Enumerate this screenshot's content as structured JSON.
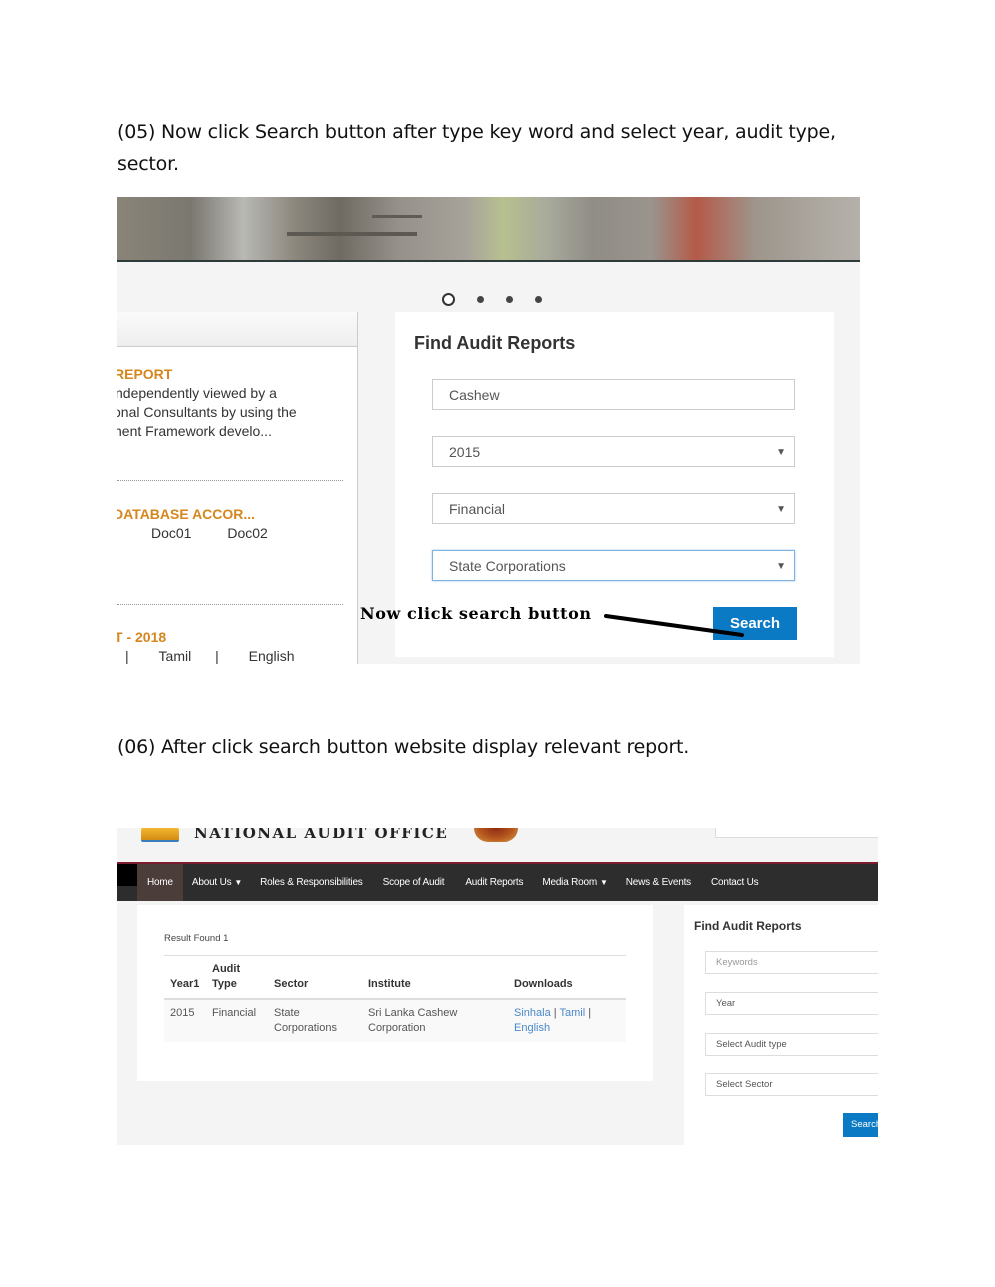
{
  "steps": {
    "step5": "(05) Now click Search button after type key word and select year, audit type, sector.",
    "step6": "(06) After click search button website display relevant report."
  },
  "screenshot1": {
    "carousel": {
      "slide_count": 4,
      "active_index": 0
    },
    "news": [
      {
        "title": "REPORT",
        "lines": [
          "ndependently viewed by a",
          "onal Consultants by using the",
          "nent Framework develo..."
        ]
      },
      {
        "title": "DATABASE ACCOR...",
        "links": [
          "Doc01",
          "Doc02"
        ]
      },
      {
        "title": "T - 2018",
        "links": [
          "|",
          "Tamil",
          "|",
          "English"
        ]
      }
    ],
    "find": {
      "title": "Find Audit Reports",
      "keyword_value": "Cashew",
      "year_value": "2015",
      "audit_type_value": "Financial",
      "sector_value": "State Corporations",
      "search_label": "Search"
    },
    "annotation": "Now click search button",
    "caret": "▼"
  },
  "screenshot2": {
    "site_title": "NATIONAL AUDIT OFFICE",
    "nav": [
      {
        "label": "Home",
        "active": true
      },
      {
        "label": "About Us",
        "dropdown": true
      },
      {
        "label": "Roles & Responsibilities"
      },
      {
        "label": "Scope of Audit"
      },
      {
        "label": "Audit Reports"
      },
      {
        "label": "Media Room",
        "dropdown": true
      },
      {
        "label": "News & Events"
      },
      {
        "label": "Contact Us"
      }
    ],
    "results": {
      "count_text": "Result Found 1",
      "headers": [
        "Year1",
        "Audit Type",
        "Sector",
        "Institute",
        "Downloads"
      ],
      "rows": [
        {
          "year": "2015",
          "audit_type": "Financial",
          "sector": "State Corporations",
          "institute": "Sri Lanka Cashew Corporation",
          "downloads": [
            "Sinhala",
            "Tamil",
            "English"
          ]
        }
      ]
    },
    "sidebar": {
      "title": "Find Audit Reports",
      "keywords_placeholder": "Keywords",
      "year_placeholder": "Year",
      "audit_type_placeholder": "Select Audit type",
      "sector_placeholder": "Select Sector",
      "search_label": "Search"
    }
  },
  "colors": {
    "accent_blue": "#0a7ac4",
    "news_title_orange": "#d6861c",
    "nav_bg": "#2d2d2d",
    "nav_border": "#7b1d2e",
    "link_blue": "#4a88c7"
  }
}
